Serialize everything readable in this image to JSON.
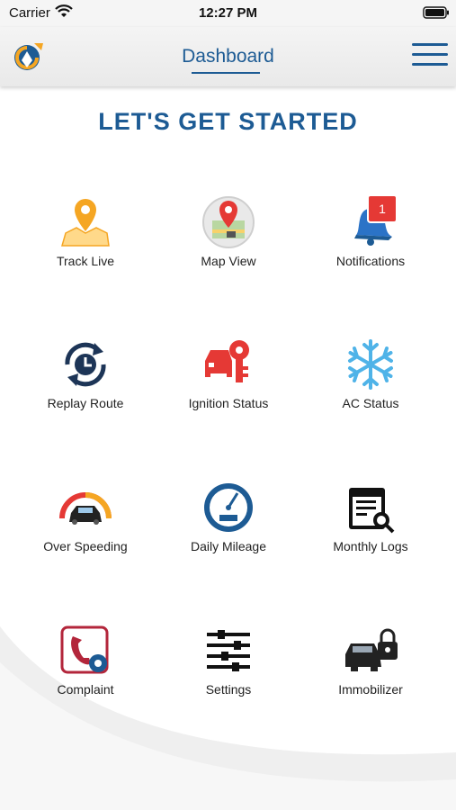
{
  "status_bar": {
    "carrier": "Carrier",
    "time": "12:27 PM"
  },
  "header": {
    "title": "Dashboard"
  },
  "heading": "LET'S GET STARTED",
  "tiles": [
    {
      "label": "Track Live",
      "icon": "map-pin-icon"
    },
    {
      "label": "Map View",
      "icon": "map-view-icon"
    },
    {
      "label": "Notifications",
      "icon": "bell-icon",
      "badge": "1"
    },
    {
      "label": "Replay Route",
      "icon": "replay-clock-icon"
    },
    {
      "label": "Ignition Status",
      "icon": "ignition-icon"
    },
    {
      "label": "AC Status",
      "icon": "snowflake-icon"
    },
    {
      "label": "Over Speeding",
      "icon": "speedometer-car-icon"
    },
    {
      "label": "Daily Mileage",
      "icon": "odometer-icon"
    },
    {
      "label": "Monthly Logs",
      "icon": "calendar-log-icon"
    },
    {
      "label": "Complaint",
      "icon": "complaint-phone-icon"
    },
    {
      "label": "Settings",
      "icon": "sliders-icon"
    },
    {
      "label": "Immobilizer",
      "icon": "car-lock-icon"
    }
  ],
  "colors": {
    "brand": "#1d5b94",
    "accent": "#f5a623",
    "alert": "#e53935"
  }
}
